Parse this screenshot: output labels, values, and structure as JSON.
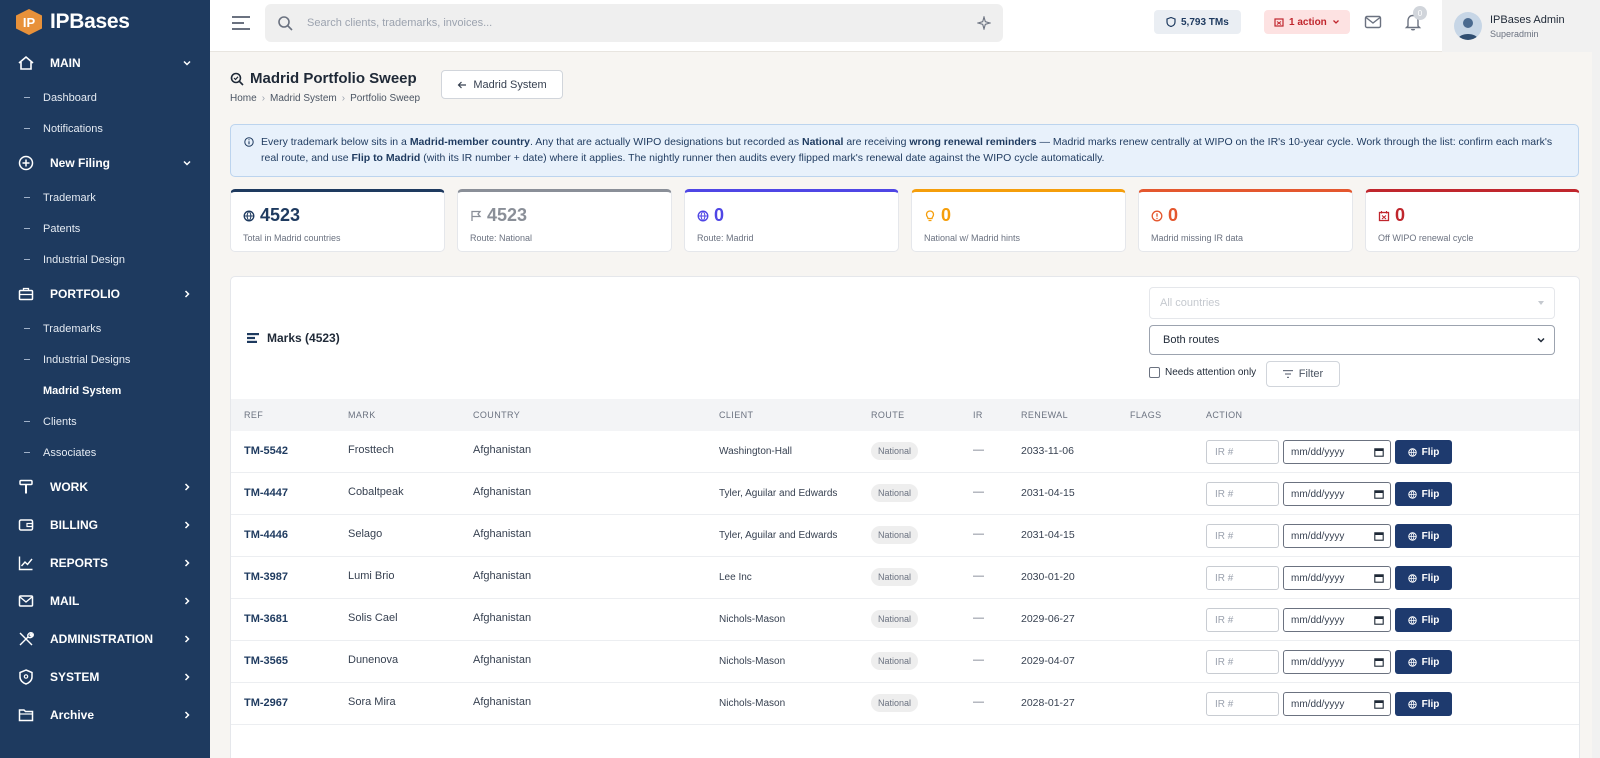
{
  "brand": {
    "logo_text": "IP",
    "name": "IPBases"
  },
  "sidebar": {
    "sections": [
      {
        "label": "MAIN",
        "expanded": true,
        "items": [
          "Dashboard",
          "Notifications"
        ]
      },
      {
        "label": "New Filing",
        "expanded": true,
        "items": [
          "Trademark",
          "Patents",
          "Industrial Design"
        ]
      },
      {
        "label": "PORTFOLIO",
        "expanded": true,
        "items": [
          "Trademarks",
          "Industrial Designs",
          "Madrid System",
          "Clients",
          "Associates"
        ]
      },
      {
        "label": "WORK"
      },
      {
        "label": "BILLING"
      },
      {
        "label": "REPORTS"
      },
      {
        "label": "MAIL"
      },
      {
        "label": "ADMINISTRATION"
      },
      {
        "label": "SYSTEM"
      },
      {
        "label": "Archive"
      }
    ],
    "active_item": "Madrid System"
  },
  "topbar": {
    "search_placeholder": "Search clients, trademarks, invoices...",
    "tm_count": "5,793 TMs",
    "action_label": "1 action",
    "notification_count": "0",
    "user_name": "IPBases Admin",
    "user_role": "Superadmin"
  },
  "page": {
    "title": "Madrid Portfolio Sweep",
    "back_button": "Madrid System",
    "breadcrumb": [
      "Home",
      "Madrid System",
      "Portfolio Sweep"
    ],
    "info_parts": [
      "Every trademark below sits in a ",
      "Madrid-member country",
      ". Any that are actually WIPO designations but recorded as ",
      "National",
      " are receiving ",
      "wrong renewal reminders",
      " — Madrid marks renew centrally at WIPO on the IR's 10-year cycle. Work through the list: confirm each mark's real route, and use ",
      "Flip to Madrid",
      " (with its IR number + date) where it applies. The nightly runner then audits every flipped mark's renewal date against the WIPO cycle automatically."
    ]
  },
  "stats": [
    {
      "value": "4523",
      "label": "Total in Madrid countries",
      "color": "#1e3a5f",
      "icon": "globe-icon"
    },
    {
      "value": "4523",
      "label": "Route: National",
      "color": "#8a8f98",
      "icon": "flag-icon"
    },
    {
      "value": "0",
      "label": "Route: Madrid",
      "color": "#4f46e5",
      "icon": "globe-icon"
    },
    {
      "value": "0",
      "label": "National w/ Madrid hints",
      "color": "#f59e0b",
      "icon": "lightbulb-icon"
    },
    {
      "value": "0",
      "label": "Madrid missing IR data",
      "color": "#e4572e",
      "icon": "alert-icon"
    },
    {
      "value": "0",
      "label": "Off WIPO renewal cycle",
      "color": "#c0262d",
      "icon": "calendar-x-icon"
    }
  ],
  "marks": {
    "title": "Marks (4523)",
    "country_placeholder": "All countries",
    "route_selected": "Both routes",
    "needs_attention_label": "Needs attention only",
    "filter_label": "Filter",
    "columns": [
      "REF",
      "MARK",
      "COUNTRY",
      "CLIENT",
      "ROUTE",
      "IR",
      "RENEWAL",
      "FLAGS",
      "ACTION"
    ],
    "ir_placeholder": "IR #",
    "date_placeholder": "mm/dd/yyyy",
    "flip_label": "Flip",
    "rows": [
      {
        "ref": "TM-5542",
        "mark": "Frosttech",
        "country": "Afghanistan",
        "client": "Washington-Hall",
        "route": "National",
        "ir": "—",
        "renewal": "2033-11-06"
      },
      {
        "ref": "TM-4447",
        "mark": "Cobaltpeak",
        "country": "Afghanistan",
        "client": "Tyler, Aguilar and Edwards",
        "route": "National",
        "ir": "—",
        "renewal": "2031-04-15"
      },
      {
        "ref": "TM-4446",
        "mark": "Selago",
        "country": "Afghanistan",
        "client": "Tyler, Aguilar and Edwards",
        "route": "National",
        "ir": "—",
        "renewal": "2031-04-15"
      },
      {
        "ref": "TM-3987",
        "mark": "Lumi Brio",
        "country": "Afghanistan",
        "client": "Lee Inc",
        "route": "National",
        "ir": "—",
        "renewal": "2030-01-20"
      },
      {
        "ref": "TM-3681",
        "mark": "Solis Cael",
        "country": "Afghanistan",
        "client": "Nichols-Mason",
        "route": "National",
        "ir": "—",
        "renewal": "2029-06-27"
      },
      {
        "ref": "TM-3565",
        "mark": "Dunenova",
        "country": "Afghanistan",
        "client": "Nichols-Mason",
        "route": "National",
        "ir": "—",
        "renewal": "2029-04-07"
      },
      {
        "ref": "TM-2967",
        "mark": "Sora Mira",
        "country": "Afghanistan",
        "client": "Nichols-Mason",
        "route": "National",
        "ir": "—",
        "renewal": "2028-01-27"
      }
    ]
  }
}
